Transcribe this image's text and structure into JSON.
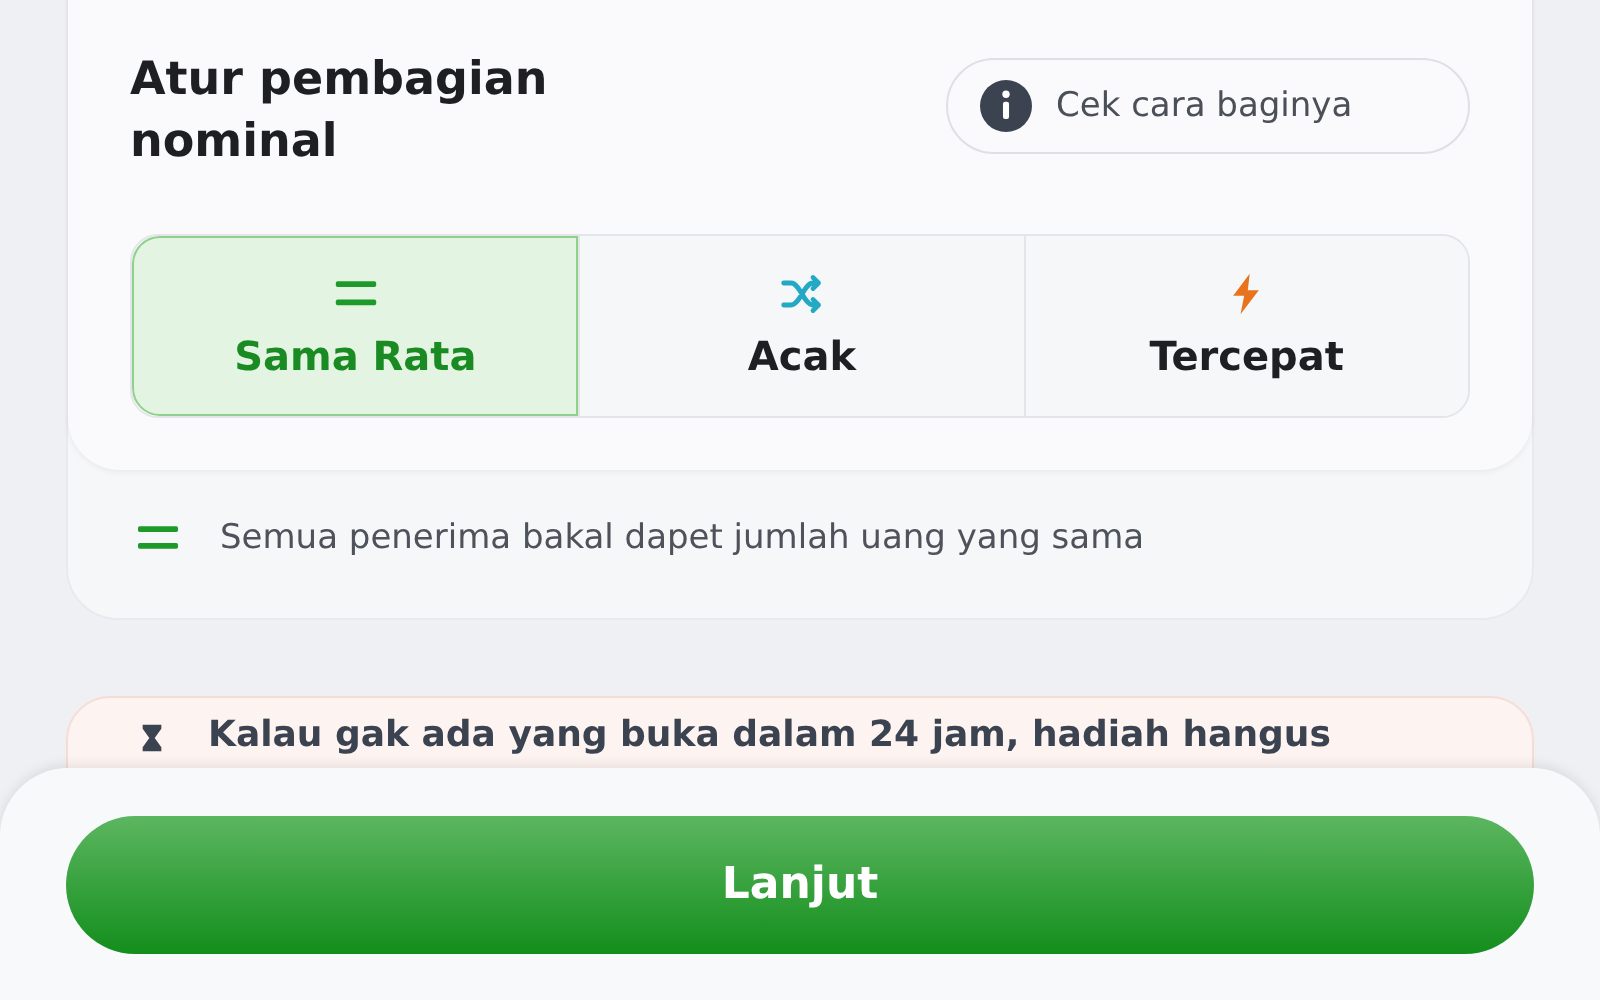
{
  "title": "Atur pembagian nominal",
  "help_button": {
    "label": "Cek cara baginya"
  },
  "options": [
    {
      "kind": "equal",
      "label": "Sama Rata",
      "selected": true
    },
    {
      "kind": "random",
      "label": "Acak",
      "selected": false
    },
    {
      "kind": "fast",
      "label": "Tercepat",
      "selected": false
    }
  ],
  "hint": {
    "kind": "equal",
    "text": "Semua penerima bakal dapet jumlah uang yang sama"
  },
  "warning": {
    "text": "Kalau gak ada yang buka dalam 24 jam, hadiah hangus"
  },
  "continue_button": {
    "label": "Lanjut"
  }
}
